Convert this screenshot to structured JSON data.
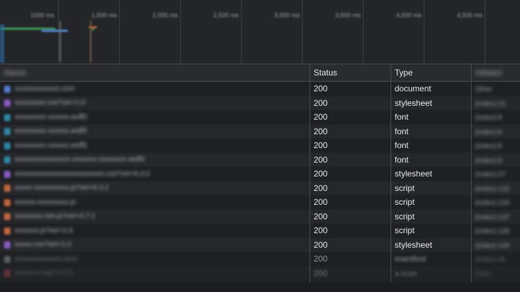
{
  "overview": {
    "ticks": [
      "1000 ms",
      "1,500 ms",
      "2,000 ms",
      "2,500 ms",
      "3,000 ms",
      "3,500 ms",
      "4,000 ms",
      "4,500 ms"
    ]
  },
  "table": {
    "columns": {
      "name": "Name",
      "status": "Status",
      "type": "Type",
      "initiator": "Initiator"
    },
    "rows": [
      {
        "name": "xxxxxxxxxxxxx.com",
        "status": "200",
        "type": "document",
        "initiator": "Other",
        "icon": "document-icon",
        "color": "#4f7fd6"
      },
      {
        "name": "xxxxxxxxx.css?ver=1.0",
        "status": "200",
        "type": "stylesheet",
        "initiator": "(index):21",
        "icon": "stylesheet-icon",
        "color": "#8b5cc9"
      },
      {
        "name": "xxxxxxxxx-xxxxxx.woff2",
        "status": "200",
        "type": "font",
        "initiator": "(index):8",
        "icon": "font-icon",
        "color": "#2a8aa8"
      },
      {
        "name": "xxxxxxxxx-xxxxxx.woff2",
        "status": "200",
        "type": "font",
        "initiator": "(index):8",
        "icon": "font-icon",
        "color": "#2a8aa8"
      },
      {
        "name": "xxxxxxxxx-xxxxxx.woff2",
        "status": "200",
        "type": "font",
        "initiator": "(index):8",
        "icon": "font-icon",
        "color": "#2a8aa8"
      },
      {
        "name": "xxxxxxxxxxxxxxxx-xxxxxxx-xxxxxxxx.woff2",
        "status": "200",
        "type": "font",
        "initiator": "(index):8",
        "icon": "font-icon",
        "color": "#2a8aa8"
      },
      {
        "name": "xxxxxxxxxxxxxxxxxxxxxxxxxx.css?ver=6.3.2",
        "status": "200",
        "type": "stylesheet",
        "initiator": "(index):27",
        "icon": "stylesheet-icon",
        "color": "#8b5cc9"
      },
      {
        "name": "xxxxx-xxxxxxxxxx.js?ver=6.3.2",
        "status": "200",
        "type": "script",
        "initiator": "(index):132",
        "icon": "script-icon",
        "color": "#c9673a"
      },
      {
        "name": "xxxxxx-xxxxxxxxx.js",
        "status": "200",
        "type": "script",
        "initiator": "(index):134",
        "icon": "script-icon",
        "color": "#c9673a"
      },
      {
        "name": "xxxxxxxx.min.js?ver=3.7.1",
        "status": "200",
        "type": "script",
        "initiator": "(index):137",
        "icon": "script-icon",
        "color": "#c9673a"
      },
      {
        "name": "xxxxxxx.js?ver=1.0",
        "status": "200",
        "type": "script",
        "initiator": "(index):138",
        "icon": "script-icon",
        "color": "#c9673a"
      },
      {
        "name": "xxxxx.css?ver=1.0",
        "status": "200",
        "type": "stylesheet",
        "initiator": "(index):140",
        "icon": "stylesheet-icon",
        "color": "#8b5cc9"
      },
      {
        "name": "xxxxxxxxxxxxxx.json",
        "status": "200",
        "type": "manifest",
        "initiator": "(index):45",
        "icon": "manifest-icon",
        "color": "#8a8d92"
      },
      {
        "name": "xxxxxxx.svg?v=1.0",
        "status": "200",
        "type": "x-icon",
        "initiator": "Other",
        "icon": "image-icon",
        "color": "#d44c4c"
      }
    ]
  },
  "colors": {
    "background": "#202124",
    "grid": "#4a4c50",
    "waterfall_green": "#3aa557",
    "waterfall_blue": "#4e8fe0"
  }
}
